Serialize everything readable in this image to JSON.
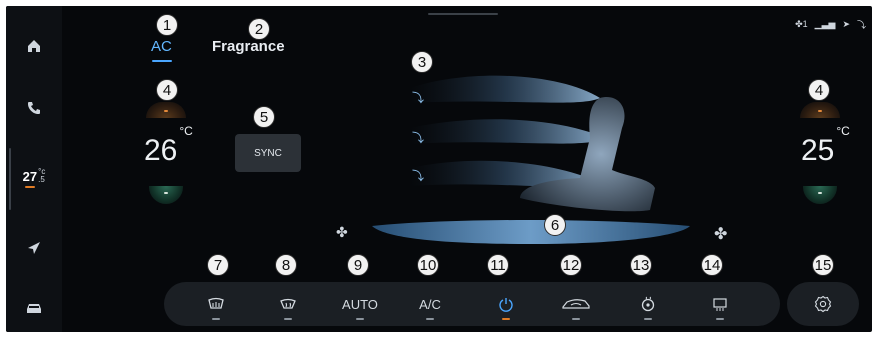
{
  "tabs": [
    {
      "label": "AC",
      "active": true
    },
    {
      "label": "Fragrance",
      "active": false
    }
  ],
  "sidebar": {
    "items": [
      {
        "icon": "home-icon"
      },
      {
        "icon": "phone-icon"
      },
      {
        "icon": "temperature-icon",
        "value": "27",
        "superscript": "°c",
        "subscript": ".5"
      },
      {
        "icon": "navigation-icon"
      },
      {
        "icon": "car-icon"
      }
    ]
  },
  "climate": {
    "left_temp": "26",
    "right_temp": "25",
    "unit": "°C",
    "sync_label": "SYNC"
  },
  "bottom_controls": [
    {
      "icon": "rear-defrost-icon",
      "label": ""
    },
    {
      "icon": "front-defrost-icon",
      "label": ""
    },
    {
      "icon": "",
      "label": "AUTO"
    },
    {
      "icon": "",
      "label": "A/C"
    },
    {
      "icon": "power-icon",
      "label": "",
      "active": true
    },
    {
      "icon": "air-recirculation-icon",
      "label": ""
    },
    {
      "icon": "steering-wheel-heat-icon",
      "label": ""
    },
    {
      "icon": "window-defrost-icon",
      "label": ""
    }
  ],
  "settings": {
    "icon": "settings-icon"
  },
  "callouts": [
    "1",
    "2",
    "3",
    "4",
    "5",
    "6",
    "7",
    "8",
    "9",
    "10",
    "11",
    "12",
    "13",
    "14",
    "15"
  ],
  "colors": {
    "background": "#06080b",
    "accent_blue": "#4aa6ff",
    "accent_orange": "#e07b24",
    "panel": "#1b1f24"
  }
}
